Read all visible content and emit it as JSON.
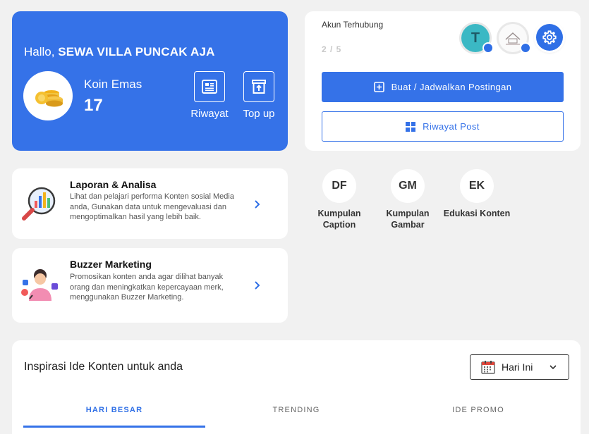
{
  "welcome": {
    "greeting": "Hallo,",
    "user_name": "SEWA VILLA PUNCAK AJA",
    "coin_label": "Koin Emas",
    "coin_value": "17",
    "history_label": "Riwayat",
    "topup_label": "Top up"
  },
  "accounts": {
    "title": "Akun Terhubung",
    "count": "2 / 5",
    "avatars": [
      "T"
    ]
  },
  "actions": {
    "create_post": "Buat / Jadwalkan Postingan",
    "post_history": "Riwayat Post"
  },
  "features": [
    {
      "title": "Laporan & Analisa",
      "description": "Lihat dan pelajari performa Konten sosial Media anda, Gunakan data untuk mengevaluasi dan mengoptimalkan hasil yang lebih baik."
    },
    {
      "title": "Buzzer Marketing",
      "description": "Promosikan konten anda agar dilihat banyak orang dan meningkatkan kepercayaan merk, menggunakan Buzzer Marketing."
    }
  ],
  "shortcuts": [
    {
      "initials": "DF",
      "label": "Kumpulan Caption"
    },
    {
      "initials": "GM",
      "label": "Kumpulan Gambar"
    },
    {
      "initials": "EK",
      "label": "Edukasi Konten"
    }
  ],
  "inspiration": {
    "title": "Inspirasi Ide Konten untuk anda",
    "period": "Hari Ini",
    "tabs": [
      "HARI BESAR",
      "TRENDING",
      "IDE PROMO"
    ],
    "active_tab": "HARI BESAR"
  },
  "colors": {
    "primary": "#3572e8",
    "background": "#f1f1f1"
  }
}
